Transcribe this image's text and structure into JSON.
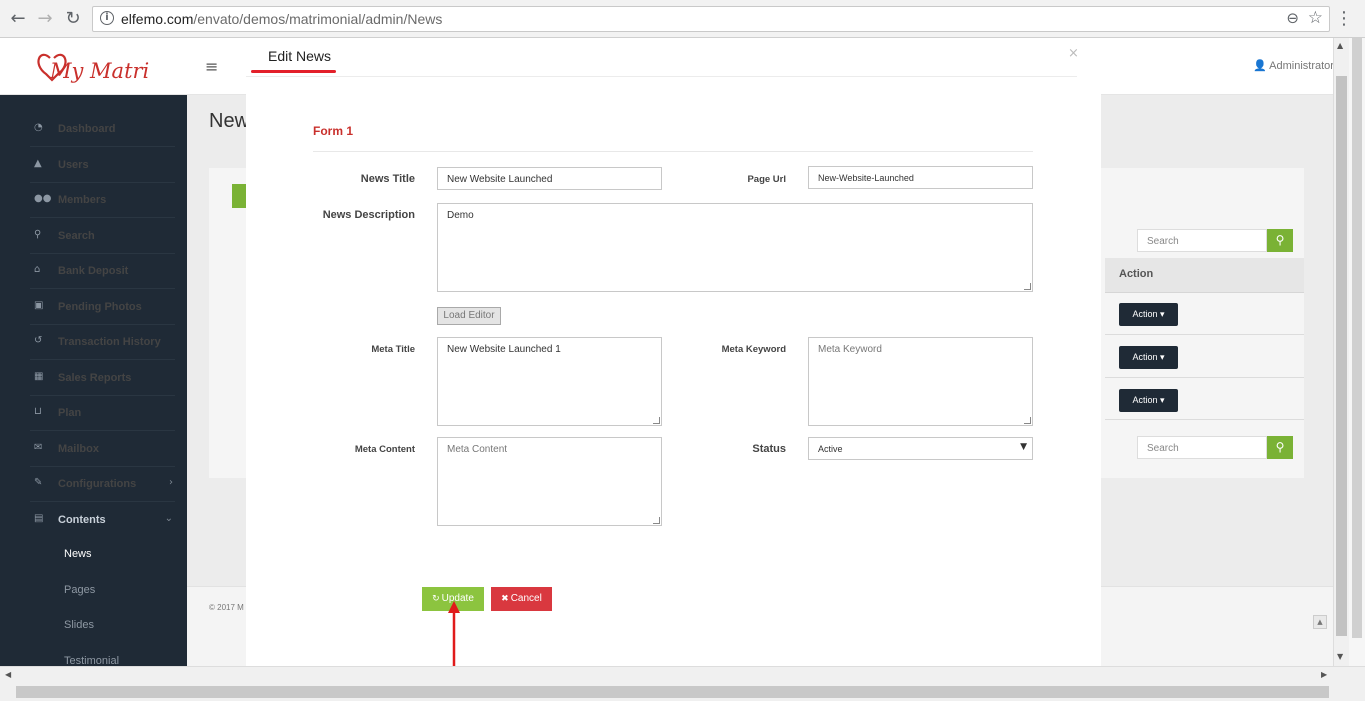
{
  "browser": {
    "url_domain": "elfemo.com",
    "url_path": "/envato/demos/matrimonial/admin/News",
    "icons": [
      "back-arrow",
      "forward-arrow",
      "reload",
      "info",
      "zoom",
      "star",
      "menu-dots"
    ]
  },
  "app": {
    "logo_text": "My Matri",
    "admin_label": "Administrator",
    "page_heading": "New",
    "footer_text": "© 2017 M"
  },
  "sidebar": {
    "items": [
      {
        "label": "Dashboard",
        "icon": "dashboard-icon"
      },
      {
        "label": "Users",
        "icon": "user-icon"
      },
      {
        "label": "Members",
        "icon": "members-icon"
      },
      {
        "label": "Search",
        "icon": "search-icon"
      },
      {
        "label": "Bank Deposit",
        "icon": "bank-icon"
      },
      {
        "label": "Pending Photos",
        "icon": "photo-icon"
      },
      {
        "label": "Transaction History",
        "icon": "history-icon"
      },
      {
        "label": "Sales Reports",
        "icon": "table-icon"
      },
      {
        "label": "Plan",
        "icon": "cart-icon"
      },
      {
        "label": "Mailbox",
        "icon": "mail-icon"
      },
      {
        "label": "Configurations",
        "icon": "wrench-icon"
      },
      {
        "label": "Contents",
        "icon": "contents-icon"
      }
    ],
    "sub_items": [
      "News",
      "Pages",
      "Slides",
      "Testimonial"
    ],
    "active_sub": "News"
  },
  "background_table": {
    "search_placeholder": "Search",
    "action_header": "Action",
    "action_button_label": "Action"
  },
  "modal": {
    "title": "Edit News",
    "close": "×",
    "form_title": "Form 1",
    "fields": {
      "news_title": {
        "label": "News Title",
        "value": "New Website Launched"
      },
      "page_url": {
        "label": "Page Url",
        "value": "New-Website-Launched"
      },
      "news_description": {
        "label": "News Description",
        "value": "Demo"
      },
      "load_editor": "Load Editor",
      "meta_title": {
        "label": "Meta Title",
        "value": "New Website Launched 1"
      },
      "meta_keyword": {
        "label": "Meta Keyword",
        "placeholder": "Meta Keyword"
      },
      "meta_content": {
        "label": "Meta Content",
        "placeholder": "Meta Content"
      },
      "status": {
        "label": "Status",
        "value": "Active"
      }
    },
    "buttons": {
      "update": "Update",
      "cancel": "Cancel"
    }
  },
  "colors": {
    "sidebar_bg": "#1f2a36",
    "accent_red": "#e3202a",
    "update_green": "#8cc43f",
    "cancel_red": "#d9383f",
    "search_green": "#7ab235"
  }
}
